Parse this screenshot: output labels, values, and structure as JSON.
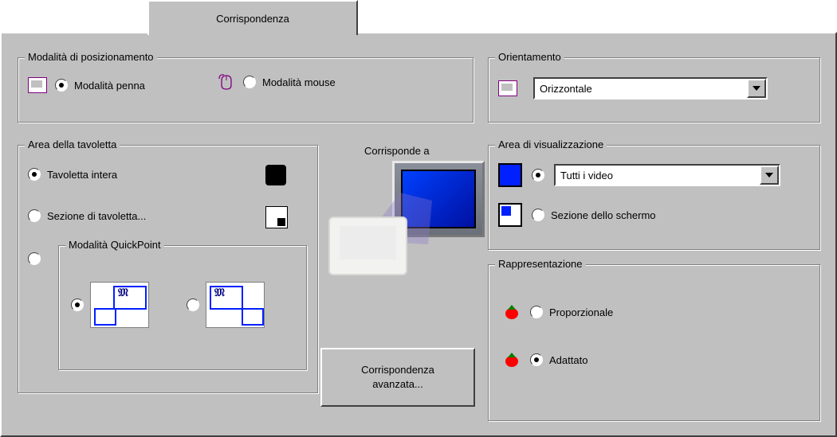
{
  "tab_label": "Corrispondenza",
  "positioning": {
    "title": "Modalità di posizionamento",
    "pen_label": "Modalità penna",
    "mouse_label": "Modalità mouse",
    "selected": "pen"
  },
  "tablet_area": {
    "title": "Area della tavoletta",
    "full_label": "Tavoletta intera",
    "section_label": "Sezione di tavoletta...",
    "quickpoint_title": "Modalità QuickPoint",
    "selected": "full",
    "quickpoint_selected": 0
  },
  "corresponds_label": "Corrisponde a",
  "orientation": {
    "title": "Orientamento",
    "value": "Orizzontale"
  },
  "display_area": {
    "title": "Area di visualizzazione",
    "all_label": "Tutti i video",
    "section_label": "Sezione dello schermo",
    "selected": "all"
  },
  "representation": {
    "title": "Rappresentazione",
    "proportional_label": "Proporzionale",
    "fitted_label": "Adattato",
    "selected": "fitted"
  },
  "advanced_button": "Corrispondenza avanzata..."
}
